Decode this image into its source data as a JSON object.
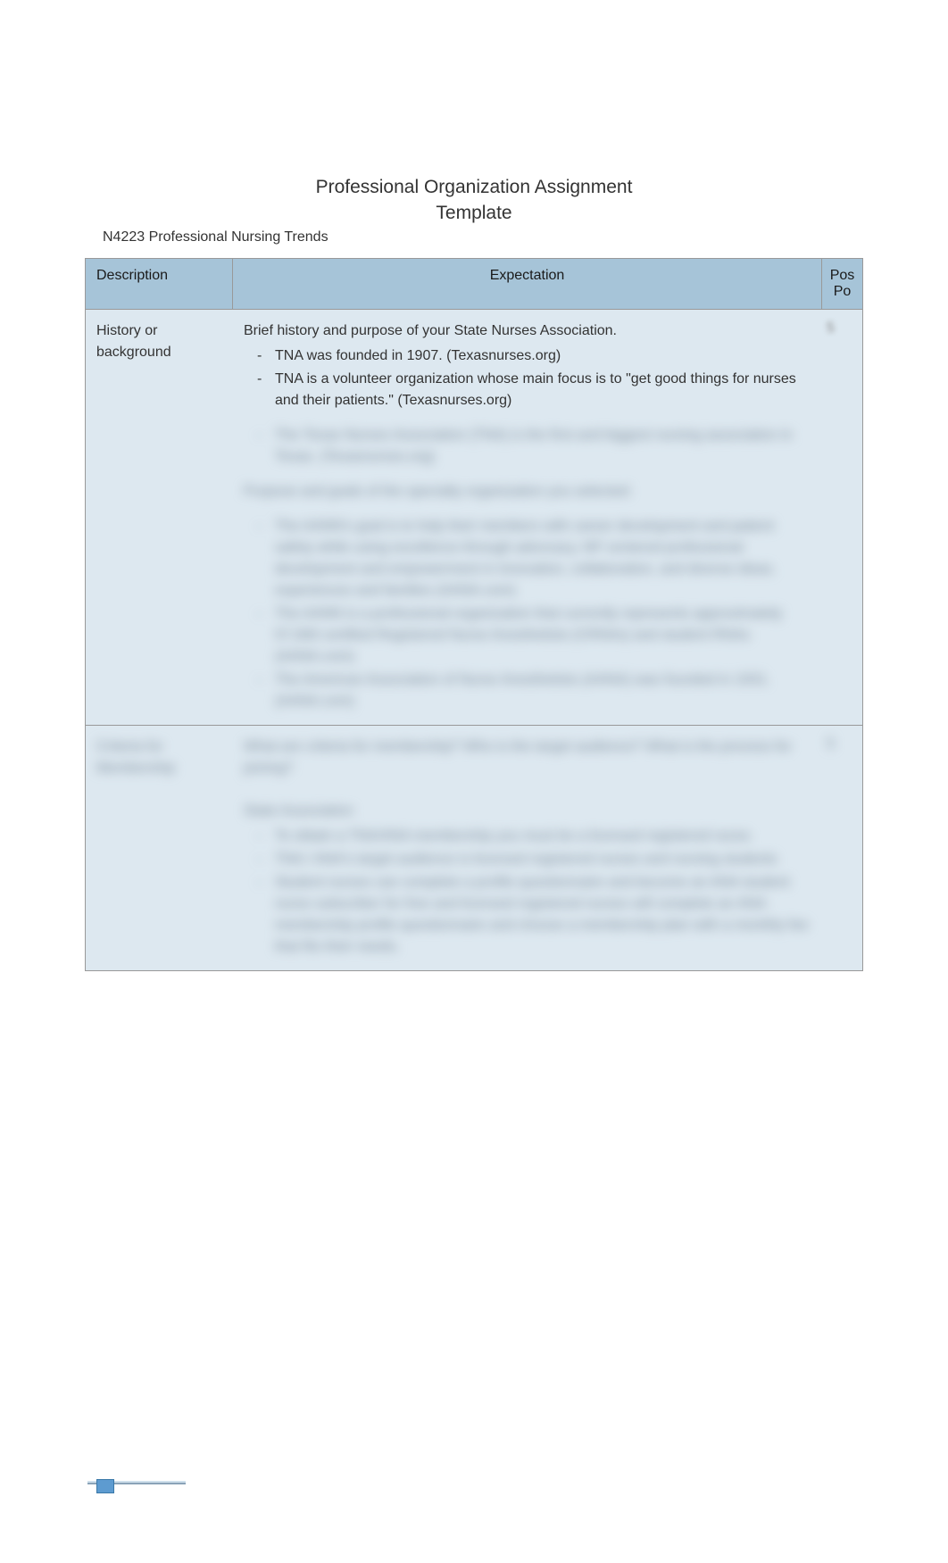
{
  "header": {
    "course_label": "N4223 Professional Nursing Trends"
  },
  "title": {
    "line1": "Professional Organization Assignment",
    "line2": "Template"
  },
  "table": {
    "headers": {
      "description": "Description",
      "expectation": "Expectation",
      "points_line1": "Pos",
      "points_line2": "Po"
    },
    "row1": {
      "description_line1": "History  or",
      "description_line2": "background",
      "expectation_intro": "Brief history and purpose of your State Nurses Association.",
      "bullets": [
        "TNA was founded in 1907. (Texasnurses.org)",
        "TNA is a volunteer organization whose main focus is to \"get good things for nurses and their patients.\" (Texasnurses.org)"
      ],
      "blurred_bullets": [
        "The Texas Nurses Association (TNA) is the first and biggest nursing association in Texas. (Texasnurses.org)"
      ],
      "blurred_section_head": "Purpose and goals of the specialty organization you selected:",
      "blurred_section_items": [
        "The AANN's goal is to help their members with career development and patient safety while using excellence through  advocacy,  NP  centered professional development  and empowerment in innovation,  collaboration, and diverse ideas.  experiences  and families   (AANA.com)",
        "The AANN is a  professional organization  that  currently  represents  approximately  57,000 certified Registered Nurse Anesthetists (CRNAs) and  student RNAs   (AANA.com)",
        "The American Association of Nurse Anesthetists (AANA)  was founded in 1931. (AANA.com)"
      ],
      "points_blurred": "5"
    },
    "row2_blurred": {
      "description": "Criteria for  Membership",
      "expectation_head": "What are criteria for membership? Who is the target audience? What is the  process for joining?",
      "subhead": "State Association",
      "items": [
        "To obtain a TNA/ANA membership you must be a licensed registered nurse.",
        "TNA / ANA's target audience is licensed registered nurses  and nursing students",
        "Student nurses can complete a profile questionnaire and become an ANA  student nurse subscriber for free  and licensed registered nurses will  complete an ANA membership profile questionnaire and choose a  membership plan with a monthly fee that fits their needs."
      ],
      "points": "5"
    }
  }
}
